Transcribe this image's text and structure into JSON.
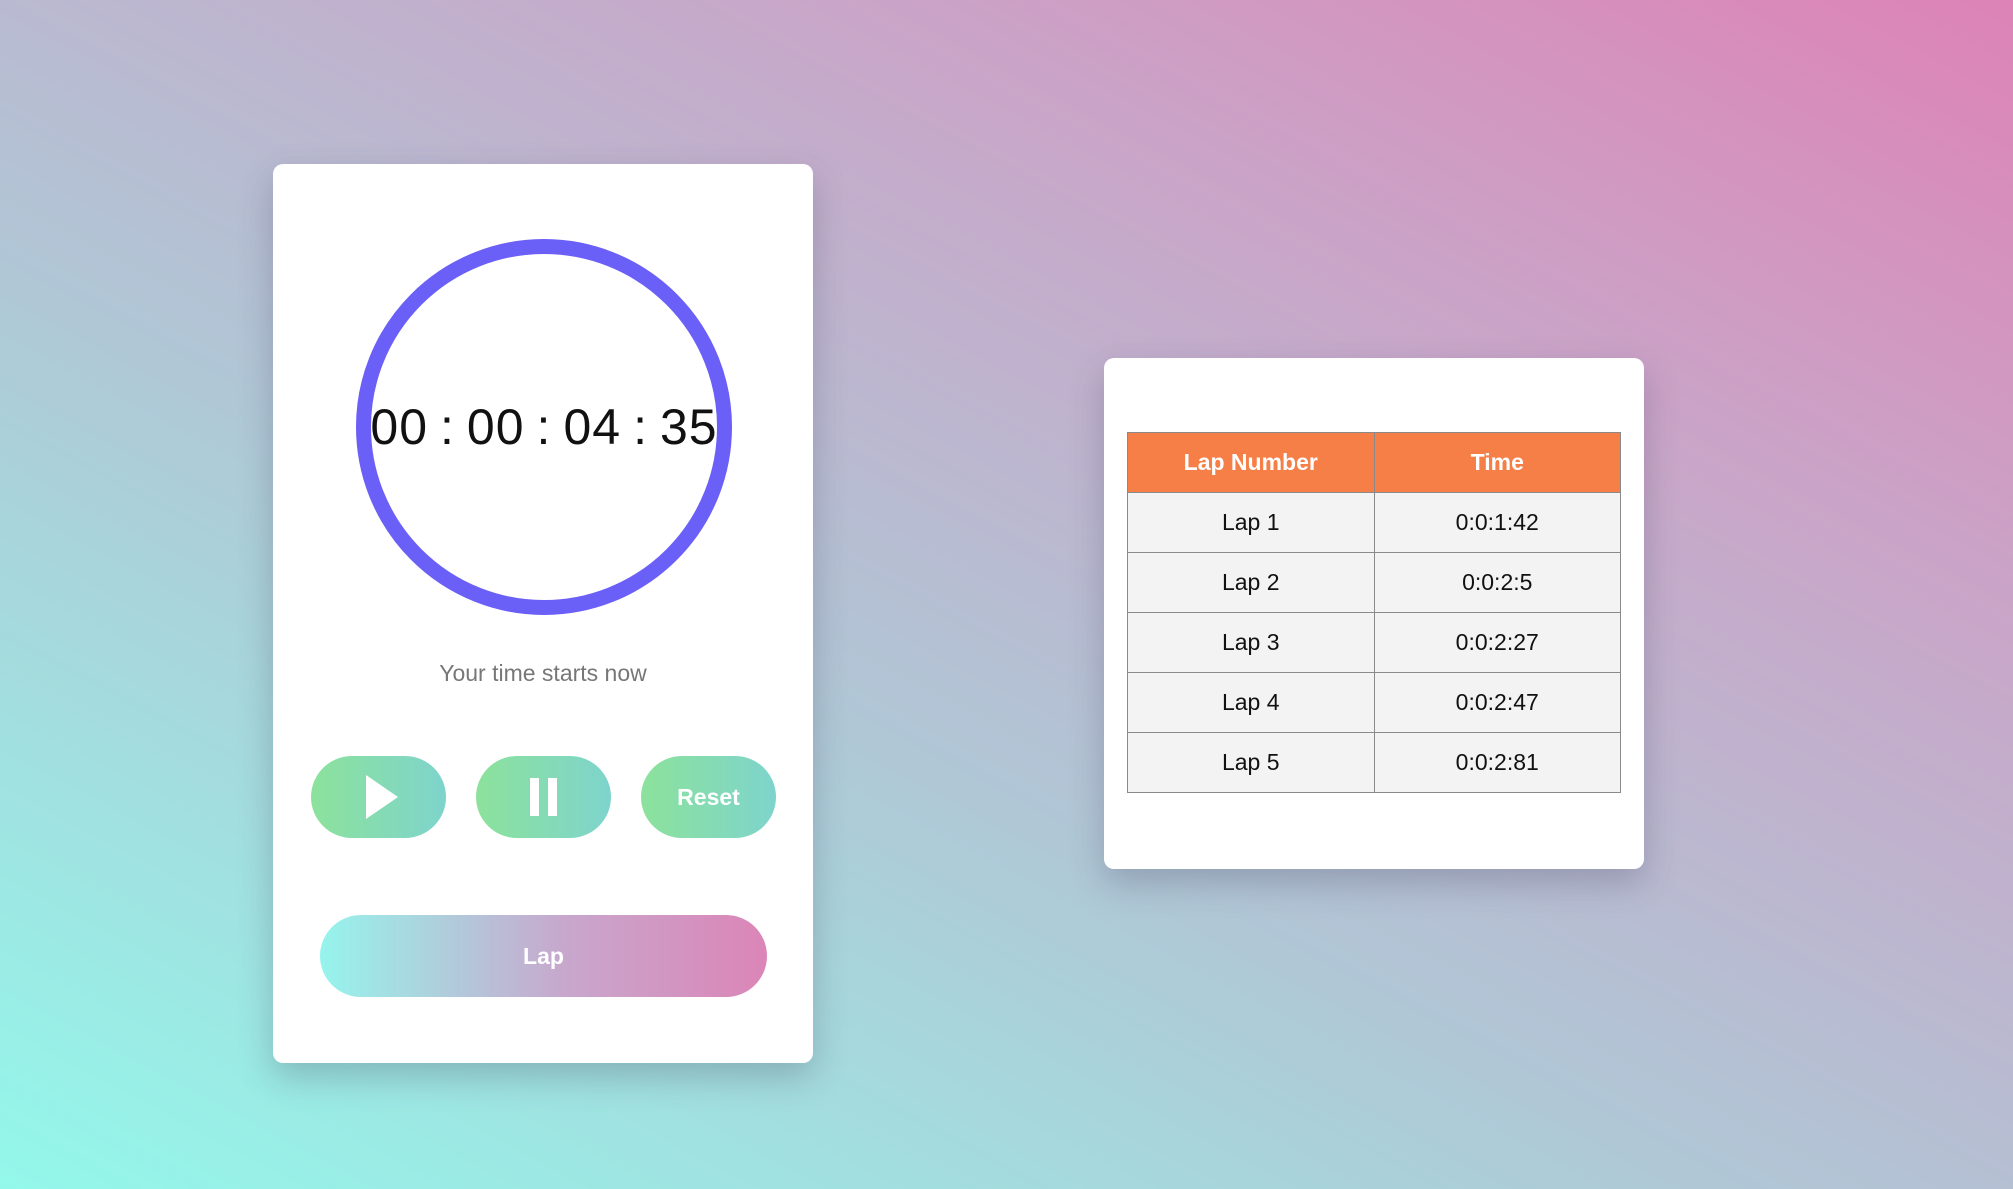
{
  "stopwatch": {
    "time": {
      "hours": "00",
      "minutes": "00",
      "seconds": "04",
      "centiseconds": "35",
      "separator": ":"
    },
    "status_text": "Your time starts now",
    "buttons": {
      "play_icon": "play-icon",
      "pause_icon": "pause-icon",
      "reset_label": "Reset",
      "lap_label": "Lap"
    },
    "colors": {
      "dial_ring": "#6a5ff7",
      "button_gradient": [
        "#8ce29b",
        "#7ed4cc"
      ],
      "lap_gradient": [
        "#96f4ec",
        "#db85b8"
      ]
    }
  },
  "laps": {
    "headers": {
      "lap_number": "Lap Number",
      "time": "Time"
    },
    "rows": [
      {
        "lap": "Lap 1",
        "time": "0:0:1:42"
      },
      {
        "lap": "Lap 2",
        "time": "0:0:2:5"
      },
      {
        "lap": "Lap 3",
        "time": "0:0:2:27"
      },
      {
        "lap": "Lap 4",
        "time": "0:0:2:47"
      },
      {
        "lap": "Lap 5",
        "time": "0:0:2:81"
      }
    ],
    "colors": {
      "header_bg": "#f67e47",
      "row_bg": "#f3f3f3"
    }
  }
}
